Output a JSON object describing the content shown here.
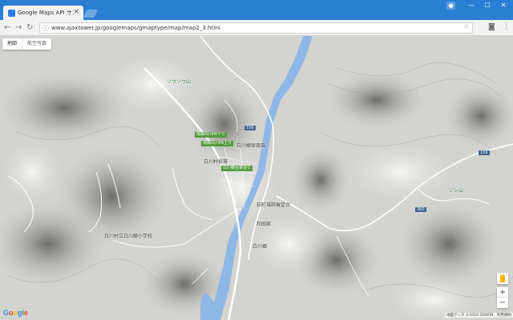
{
  "browser": {
    "tab_title": "Google Maps API サンプル",
    "tab_close": "×",
    "url": "www.ajaxtower.jp/googlemaps/gmaptype/map/map2_3.html",
    "win_min": "—",
    "win_max": "☐",
    "win_close": "✕"
  },
  "map": {
    "type_map": "地図",
    "type_satellite": "航空写真",
    "labels": {
      "mountain_1": "ソウソウ山",
      "mountain_2": "ジシ山",
      "school_1": "白川郷保育園",
      "village_office": "白川村役場",
      "cultural_site": "白川郷合掌造り",
      "wada_house": "和田家",
      "ogimachi": "荻町城跡展望台",
      "shirakawa_go": "白川郷",
      "school_2": "白川村立白川郷小学校",
      "road_1": "飛騨白川PA下り",
      "road_2": "飛騨白川PA上り",
      "route_156": "156",
      "route_360": "360",
      "shield_1": "156",
      "shield_2": "360"
    },
    "zoom_in": "+",
    "zoom_out": "−",
    "logo": "Google",
    "attribution": "地図データ ©2016 ZENRIN　利用規約"
  },
  "colors": {
    "chrome_blue": "#2a7fd4",
    "river": "#8fb7e6",
    "road": "#ffffff"
  }
}
